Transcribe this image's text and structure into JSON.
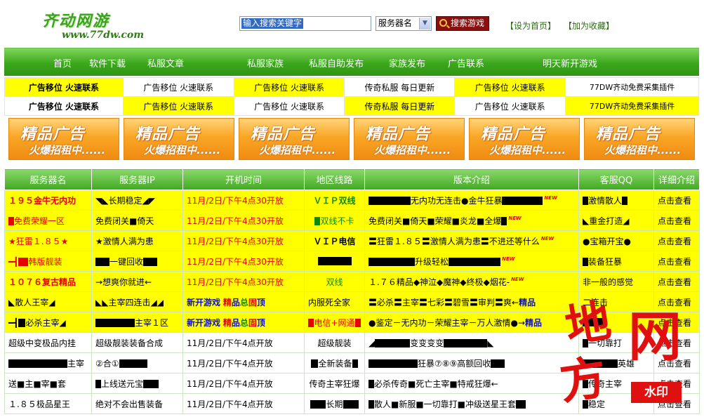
{
  "header": {
    "logo_title": "齐动网游",
    "logo_url": "www.77dw.com",
    "search_value": "输入搜索关键字",
    "select_value": "服务器名",
    "search_button": "搜索游戏",
    "set_home": "【设为首页】",
    "favorite": "【加为收藏】"
  },
  "nav": [
    "首页",
    "软件下载",
    "私服文章",
    "私服家族",
    "私服自助发布",
    "家族发布",
    "广告联系",
    "明天新开游戏"
  ],
  "ad_rows": [
    [
      "广告移位 火速联系",
      "广告移位 火速联系",
      "广告移位 火速联系",
      "传奇私服 每日更新",
      "广告移位 火速联系",
      "77DW齐动免费采集插件"
    ],
    [
      "广告移位 火速联系",
      "广告移位 火速联系",
      "广告移位 火速联系",
      "传奇私服 每日更新",
      "广告移位 火速联系",
      "77DW齐动免费采集插件"
    ]
  ],
  "banner": {
    "line1": "精品广告",
    "line2": "火爆招租中......"
  },
  "table": {
    "headers": [
      "服务器名",
      "服务器IP",
      "开机时间",
      "地区线路",
      "版本介绍",
      "客服QQ",
      "详细介绍"
    ],
    "detail": "点击查看",
    "time": "11月/2日/下午4点30开放",
    "time2": "11月/2日/下午4点开放",
    "rows": [
      {
        "name": "１９５金牛无内功",
        "ip": "长期稳定",
        "line": "ＶＩＰ双线",
        "intro": "无内功无连击●金牛狂暴",
        "qq": "激情散人"
      },
      {
        "name": "免费荣耀一区",
        "ip": "免费闭关■倚天",
        "line": "双线不卡",
        "intro": "免费闭关■倚天■荣耀■炎龙■全爆",
        "qq": "重金打造"
      },
      {
        "name": "★狂雷１.８５★",
        "ip": "★激情人满为患",
        "line": "ＶＩＰ电信",
        "intro": "〓狂雷１.８５〓激情人满为患〓不进还等什么",
        "qq": "●宝箱开宝●"
      },
      {
        "name": "韩版靓装",
        "ip": "一键回收",
        "line": "",
        "intro": "升级轻松",
        "qq": "装备狂暴"
      },
      {
        "name": "１０７６复古精品",
        "ip": "→想爽你就进←",
        "line": "双线",
        "intro": "１.７６精品◆神泣◆魔神◆终极◆烟花-",
        "qq": "非一般的感觉"
      },
      {
        "name": "散人王宰",
        "ip": "主宰四连击",
        "time_a": "新开游戏",
        "time_b": "精",
        "time_c": "品",
        "time_d": "总",
        "time_e": "固",
        "time_f": "顶",
        "line": "内服死全家",
        "intro": "〓必杀〓主宰〓七彩〓碧雪〓审判〓爽←",
        "intro_b": "精品",
        "qq": "二连击"
      },
      {
        "name": "必杀主宰",
        "ip": "主宰１区",
        "line": "电信+网通",
        "intro": "●鉴定－无内功－荣耀主宰－万人激情●→",
        "intro_b": "精品",
        "qq": ""
      },
      {
        "name": "超级中变极品内挂",
        "ip": "超级靓装装备合成",
        "line": "超级靓装",
        "intro": "变变变变",
        "qq": "一切靠打"
      },
      {
        "name": "主宰",
        "ip": "②合①",
        "line": "全新装备",
        "intro": "狂暴⑦⑧⑨高额回收",
        "qq": "英雄"
      },
      {
        "name": "送■主■宰■套",
        "ip": "上线送元宝",
        "line": "传奇主宰狂爆",
        "intro": "必杀传奇■死亡主宰■特戒狂爆←",
        "qq": "传奇主宰"
      },
      {
        "name": "１.８５极品星王",
        "ip": "绝对不会出售装备",
        "line": "长期",
        "intro": "散人■新服■一切靠打■冲级送星王套",
        "qq": "稳定"
      }
    ]
  },
  "watermark": {
    "c1": "地",
    "c2": "网",
    "c3": "方",
    "tag": "水印"
  }
}
